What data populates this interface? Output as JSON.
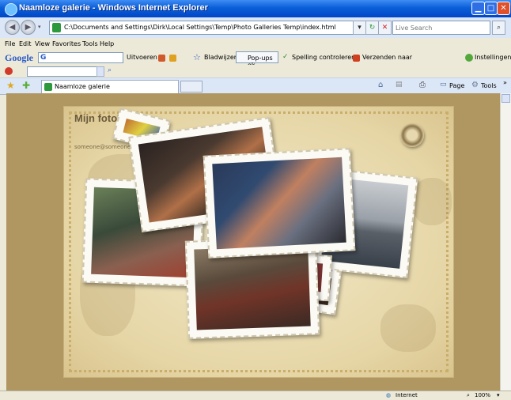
{
  "window": {
    "title": "Naamloze galerie - Windows Internet Explorer"
  },
  "address_bar": {
    "url": "C:\\Documents and Settings\\Dirk\\Local Settings\\Temp\\Photo Galleries Temp\\index.html"
  },
  "search": {
    "placeholder": "Live Search"
  },
  "menu": {
    "items": [
      "File",
      "Edit",
      "View",
      "Favorites",
      "Tools",
      "Help"
    ]
  },
  "google_toolbar": {
    "logo": "Google",
    "search_label": "G",
    "run_label": "Uitvoeren",
    "bookmarks_label": "Bladwijzers",
    "popups_label": "Pop-ups ok",
    "spelling_label": "Spelling controleren",
    "send_label": "Verzenden naar",
    "settings_label": "Instellingen"
  },
  "tabs": [
    {
      "label": "Naamloze galerie"
    }
  ],
  "command_bar": {
    "page_label": "Page",
    "tools_label": "Tools"
  },
  "page": {
    "title": "Mijn foto'",
    "email": "someone@someone.net"
  },
  "status": {
    "zone": "Internet",
    "zoom": "100%"
  },
  "icons": [
    "ie-icon",
    "back-icon",
    "forward-icon",
    "page-icon",
    "refresh-icon",
    "stop-icon",
    "search-icon",
    "favorites-star-icon",
    "add-favorites-icon",
    "home-icon",
    "feed-icon",
    "print-icon",
    "globe-icon",
    "compass-icon"
  ]
}
